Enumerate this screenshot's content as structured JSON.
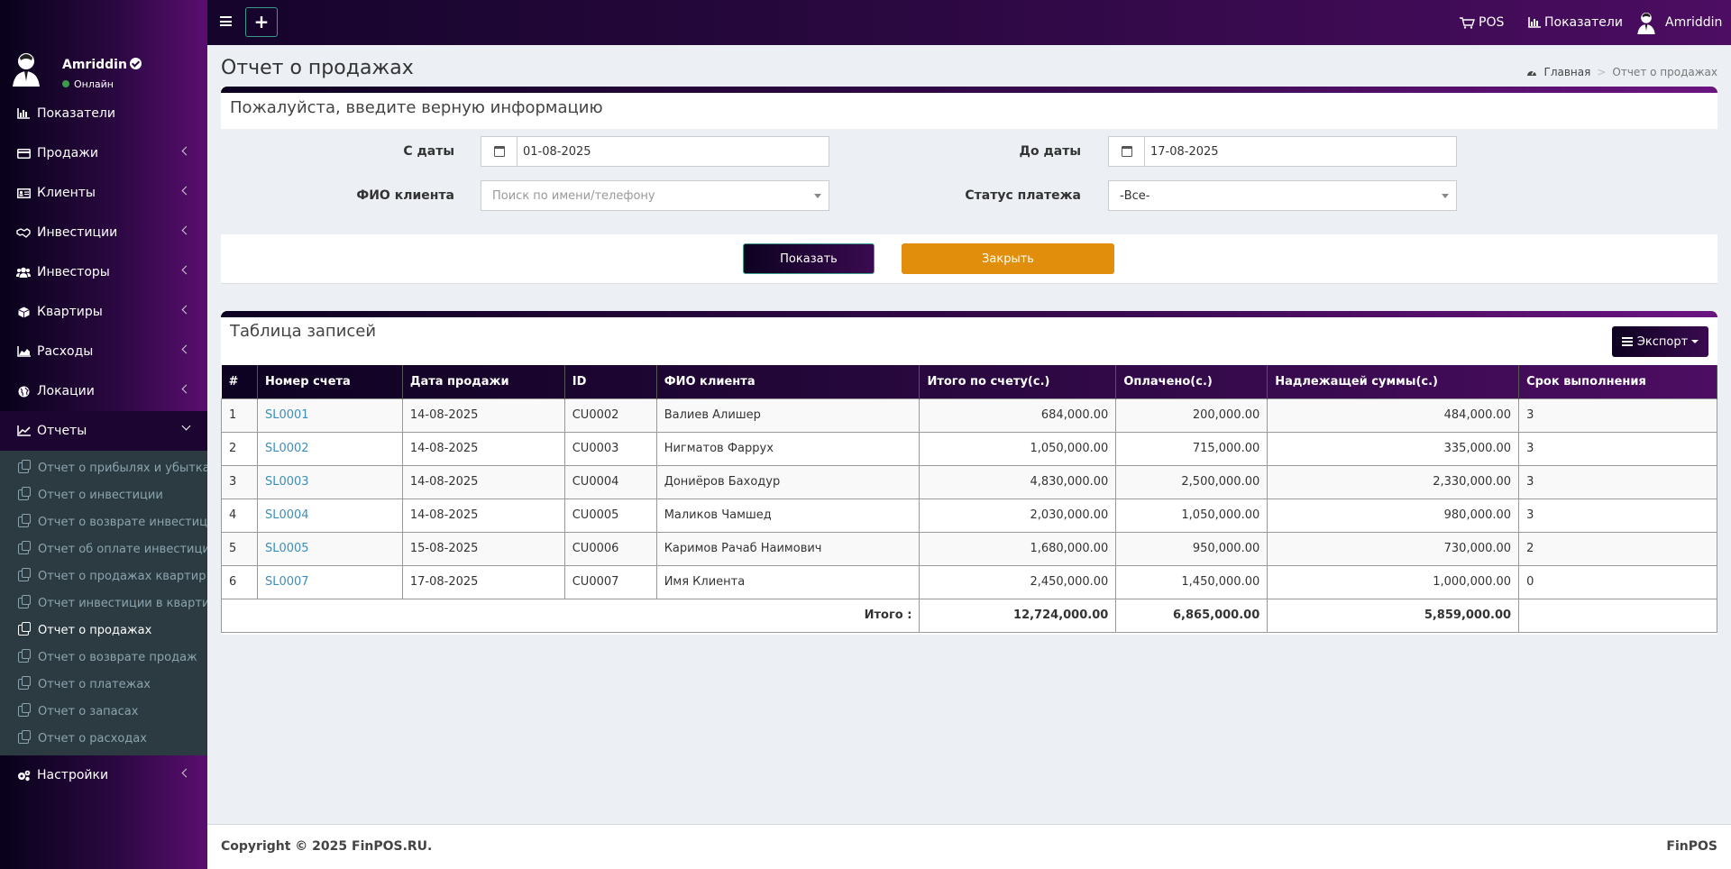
{
  "header": {
    "pos_label": "POS",
    "dashboard_label": "Показатели",
    "user_name": "Amriddin"
  },
  "sidebar": {
    "user_name": "Amriddin",
    "user_status": "Онлайн",
    "items": [
      {
        "label": "Показатели",
        "icon": "bar-chart-icon"
      },
      {
        "label": "Продажи",
        "icon": "credit-card-icon"
      },
      {
        "label": "Клиенты",
        "icon": "id-card-icon"
      },
      {
        "label": "Инвестиции",
        "icon": "handshake-icon"
      },
      {
        "label": "Инвесторы",
        "icon": "users-icon"
      },
      {
        "label": "Квартиры",
        "icon": "cube-icon"
      },
      {
        "label": "Расходы",
        "icon": "area-chart-icon"
      },
      {
        "label": "Локации",
        "icon": "globe-icon"
      },
      {
        "label": "Отчеты",
        "icon": "line-chart-icon"
      },
      {
        "label": "Настройки",
        "icon": "cogs-icon"
      }
    ],
    "reports_sub": [
      "Отчет о прибылях и убытках",
      "Отчет о инвестиции",
      "Отчет о возврате инвестиции",
      "Отчет об оплате инвестиции",
      "Отчет о продажах квартир",
      "Отчет инвестиции в квартиры",
      "Отчет о продажах",
      "Отчет о возврате продаж",
      "Отчет о платежах",
      "Отчет о запасах",
      "Отчет о расходах"
    ],
    "active_sub": "Отчет о продажах"
  },
  "page": {
    "title": "Отчет о продажах",
    "breadcrumb_home": "Главная",
    "breadcrumb_current": "Отчет о продажах"
  },
  "filter": {
    "title": "Пожалуйста, введите верную информацию",
    "from_label": "С даты",
    "from_value": "01-08-2025",
    "to_label": "До даты",
    "to_value": "17-08-2025",
    "client_label": "ФИО клиента",
    "client_placeholder": "Поиск по имени/телефону",
    "status_label": "Статус платежа",
    "status_value": "-Все-",
    "show_button": "Показать",
    "close_button": "Закрыть"
  },
  "records": {
    "title": "Таблица записей",
    "export_button": "Экспорт",
    "columns": [
      "#",
      "Номер счета",
      "Дата продажи",
      "ID",
      "ФИО клиента",
      "Итого по счету(с.)",
      "Оплачено(с.)",
      "Надлежащей суммы(с.)",
      "Срок выполнения"
    ],
    "rows": [
      [
        "1",
        "SL0001",
        "14-08-2025",
        "CU0002",
        "Валиев Алишер",
        "684,000.00",
        "200,000.00",
        "484,000.00",
        "3"
      ],
      [
        "2",
        "SL0002",
        "14-08-2025",
        "CU0003",
        "Нигматов Фаррух",
        "1,050,000.00",
        "715,000.00",
        "335,000.00",
        "3"
      ],
      [
        "3",
        "SL0003",
        "14-08-2025",
        "CU0004",
        "Дониёров Баходур",
        "4,830,000.00",
        "2,500,000.00",
        "2,330,000.00",
        "3"
      ],
      [
        "4",
        "SL0004",
        "14-08-2025",
        "CU0005",
        "Маликов Чамшед",
        "2,030,000.00",
        "1,050,000.00",
        "980,000.00",
        "3"
      ],
      [
        "5",
        "SL0005",
        "15-08-2025",
        "CU0006",
        "Каримов Рачаб Наимович",
        "1,680,000.00",
        "950,000.00",
        "730,000.00",
        "2"
      ],
      [
        "6",
        "SL0007",
        "17-08-2025",
        "CU0007",
        "Имя Клиента",
        "2,450,000.00",
        "1,450,000.00",
        "1,000,000.00",
        "0"
      ]
    ],
    "total_label": "Итого :",
    "total_invoice": "12,724,000.00",
    "total_paid": "6,865,000.00",
    "total_due": "5,859,000.00"
  },
  "footer": {
    "copyright": "Copyright © 2025 FinPOS.RU.",
    "brand": "FinPOS"
  },
  "colors": {
    "accent_dark": "#0d0221",
    "accent_purple": "#4c0d62",
    "close_button": "#e08e0b",
    "link": "#3c8dbc"
  }
}
